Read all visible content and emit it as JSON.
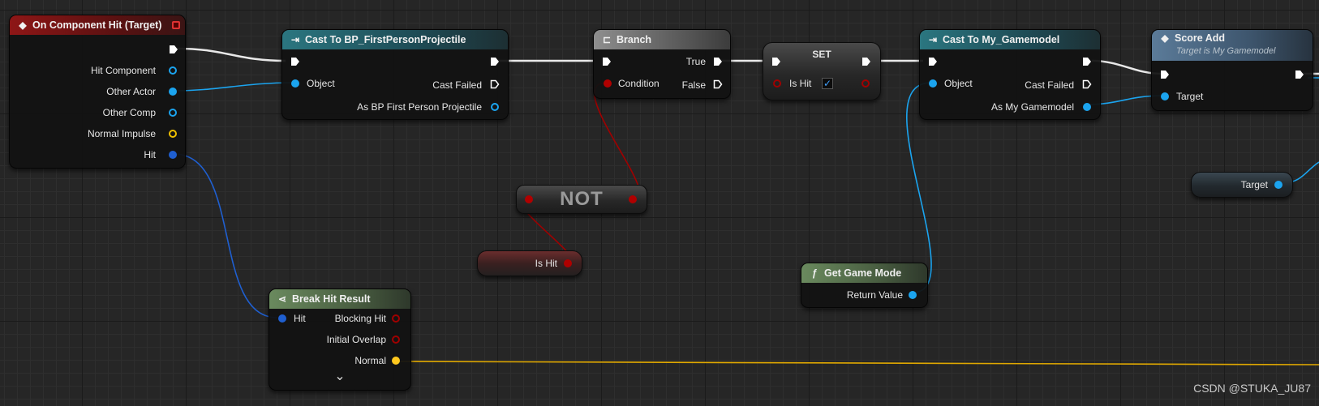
{
  "nodes": {
    "on_hit": {
      "title": "On Component Hit (Target)",
      "pins": [
        "Hit Component",
        "Other Actor",
        "Other Comp",
        "Normal Impulse",
        "Hit"
      ]
    },
    "cast_projectile": {
      "title": "Cast To BP_FirstPersonProjectile",
      "object": "Object",
      "cast_failed": "Cast Failed",
      "as_output": "As BP First Person Projectile"
    },
    "branch": {
      "title": "Branch",
      "condition": "Condition",
      "true_label": "True",
      "false_label": "False"
    },
    "set": {
      "title": "SET",
      "var": "Is Hit",
      "checked": "✓"
    },
    "cast_gamemodel": {
      "title": "Cast To My_Gamemodel",
      "object": "Object",
      "cast_failed": "Cast Failed",
      "as_output": "As My Gamemodel"
    },
    "score_add": {
      "title": "Score Add",
      "subtitle": "Target is My Gamemodel",
      "target": "Target"
    },
    "target_ref": {
      "label": "Target"
    },
    "not": {
      "label": "NOT"
    },
    "is_hit_get": {
      "label": "Is Hit"
    },
    "get_game_mode": {
      "title": "Get Game Mode",
      "icon": "ƒ",
      "return_value": "Return Value"
    },
    "break_hit": {
      "title": "Break Hit Result",
      "hit": "Hit",
      "blocking_hit": "Blocking Hit",
      "initial_overlap": "Initial Overlap",
      "normal": "Normal",
      "expand": "⌄"
    }
  },
  "colors": {
    "exec": "#ffffff",
    "object": "#1ba4ef",
    "bool": "#a00000",
    "vector": "#f0c000"
  },
  "watermark": "CSDN @STUKA_JU87"
}
